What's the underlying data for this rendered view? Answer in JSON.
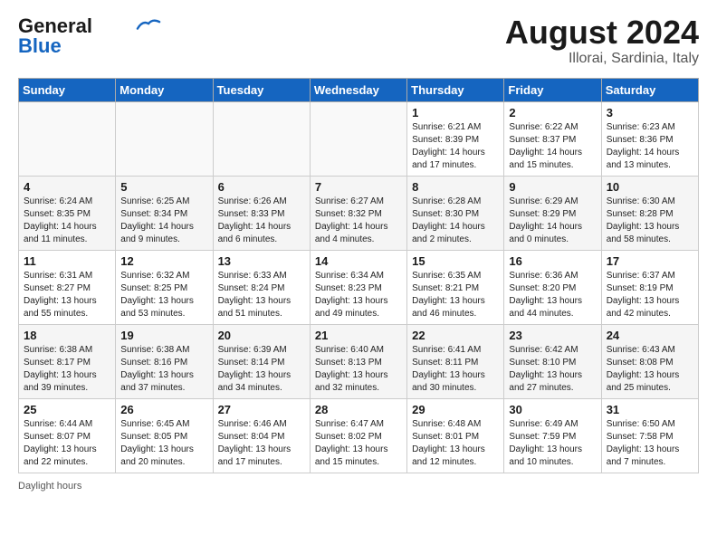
{
  "header": {
    "logo_general": "General",
    "logo_blue": "Blue",
    "month_year": "August 2024",
    "location": "Illorai, Sardinia, Italy"
  },
  "calendar": {
    "days_of_week": [
      "Sunday",
      "Monday",
      "Tuesday",
      "Wednesday",
      "Thursday",
      "Friday",
      "Saturday"
    ],
    "weeks": [
      [
        {
          "day": "",
          "empty": true
        },
        {
          "day": "",
          "empty": true
        },
        {
          "day": "",
          "empty": true
        },
        {
          "day": "",
          "empty": true
        },
        {
          "day": "1",
          "sunrise": "6:21 AM",
          "sunset": "8:39 PM",
          "daylight": "14 hours and 17 minutes."
        },
        {
          "day": "2",
          "sunrise": "6:22 AM",
          "sunset": "8:37 PM",
          "daylight": "14 hours and 15 minutes."
        },
        {
          "day": "3",
          "sunrise": "6:23 AM",
          "sunset": "8:36 PM",
          "daylight": "14 hours and 13 minutes."
        }
      ],
      [
        {
          "day": "4",
          "sunrise": "6:24 AM",
          "sunset": "8:35 PM",
          "daylight": "14 hours and 11 minutes."
        },
        {
          "day": "5",
          "sunrise": "6:25 AM",
          "sunset": "8:34 PM",
          "daylight": "14 hours and 9 minutes."
        },
        {
          "day": "6",
          "sunrise": "6:26 AM",
          "sunset": "8:33 PM",
          "daylight": "14 hours and 6 minutes."
        },
        {
          "day": "7",
          "sunrise": "6:27 AM",
          "sunset": "8:32 PM",
          "daylight": "14 hours and 4 minutes."
        },
        {
          "day": "8",
          "sunrise": "6:28 AM",
          "sunset": "8:30 PM",
          "daylight": "14 hours and 2 minutes."
        },
        {
          "day": "9",
          "sunrise": "6:29 AM",
          "sunset": "8:29 PM",
          "daylight": "14 hours and 0 minutes."
        },
        {
          "day": "10",
          "sunrise": "6:30 AM",
          "sunset": "8:28 PM",
          "daylight": "13 hours and 58 minutes."
        }
      ],
      [
        {
          "day": "11",
          "sunrise": "6:31 AM",
          "sunset": "8:27 PM",
          "daylight": "13 hours and 55 minutes."
        },
        {
          "day": "12",
          "sunrise": "6:32 AM",
          "sunset": "8:25 PM",
          "daylight": "13 hours and 53 minutes."
        },
        {
          "day": "13",
          "sunrise": "6:33 AM",
          "sunset": "8:24 PM",
          "daylight": "13 hours and 51 minutes."
        },
        {
          "day": "14",
          "sunrise": "6:34 AM",
          "sunset": "8:23 PM",
          "daylight": "13 hours and 49 minutes."
        },
        {
          "day": "15",
          "sunrise": "6:35 AM",
          "sunset": "8:21 PM",
          "daylight": "13 hours and 46 minutes."
        },
        {
          "day": "16",
          "sunrise": "6:36 AM",
          "sunset": "8:20 PM",
          "daylight": "13 hours and 44 minutes."
        },
        {
          "day": "17",
          "sunrise": "6:37 AM",
          "sunset": "8:19 PM",
          "daylight": "13 hours and 42 minutes."
        }
      ],
      [
        {
          "day": "18",
          "sunrise": "6:38 AM",
          "sunset": "8:17 PM",
          "daylight": "13 hours and 39 minutes."
        },
        {
          "day": "19",
          "sunrise": "6:38 AM",
          "sunset": "8:16 PM",
          "daylight": "13 hours and 37 minutes."
        },
        {
          "day": "20",
          "sunrise": "6:39 AM",
          "sunset": "8:14 PM",
          "daylight": "13 hours and 34 minutes."
        },
        {
          "day": "21",
          "sunrise": "6:40 AM",
          "sunset": "8:13 PM",
          "daylight": "13 hours and 32 minutes."
        },
        {
          "day": "22",
          "sunrise": "6:41 AM",
          "sunset": "8:11 PM",
          "daylight": "13 hours and 30 minutes."
        },
        {
          "day": "23",
          "sunrise": "6:42 AM",
          "sunset": "8:10 PM",
          "daylight": "13 hours and 27 minutes."
        },
        {
          "day": "24",
          "sunrise": "6:43 AM",
          "sunset": "8:08 PM",
          "daylight": "13 hours and 25 minutes."
        }
      ],
      [
        {
          "day": "25",
          "sunrise": "6:44 AM",
          "sunset": "8:07 PM",
          "daylight": "13 hours and 22 minutes."
        },
        {
          "day": "26",
          "sunrise": "6:45 AM",
          "sunset": "8:05 PM",
          "daylight": "13 hours and 20 minutes."
        },
        {
          "day": "27",
          "sunrise": "6:46 AM",
          "sunset": "8:04 PM",
          "daylight": "13 hours and 17 minutes."
        },
        {
          "day": "28",
          "sunrise": "6:47 AM",
          "sunset": "8:02 PM",
          "daylight": "13 hours and 15 minutes."
        },
        {
          "day": "29",
          "sunrise": "6:48 AM",
          "sunset": "8:01 PM",
          "daylight": "13 hours and 12 minutes."
        },
        {
          "day": "30",
          "sunrise": "6:49 AM",
          "sunset": "7:59 PM",
          "daylight": "13 hours and 10 minutes."
        },
        {
          "day": "31",
          "sunrise": "6:50 AM",
          "sunset": "7:58 PM",
          "daylight": "13 hours and 7 minutes."
        }
      ]
    ]
  },
  "footer": {
    "daylight_label": "Daylight hours"
  }
}
